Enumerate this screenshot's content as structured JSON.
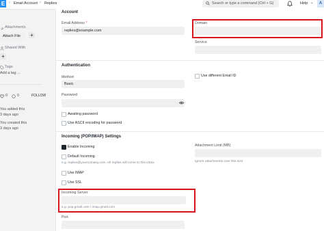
{
  "topbar": {
    "logo": "E",
    "breadcrumbs": [
      "Email Account",
      "Replies"
    ],
    "search_placeholder": "Search or type a command (Ctrl + G)",
    "help_label": "Help",
    "avatar_initial": "A"
  },
  "sidebar": {
    "attachments_label": "Attachments",
    "attach_file_label": "Attach File",
    "shared_with_label": "Shared With",
    "tags_label": "Tags",
    "add_tag_label": "Add a tag ...",
    "likes_count": "0",
    "comments_count": "0",
    "follow_label": "FOLLOW",
    "added_text": "You added this",
    "added_time": "3 days ago",
    "created_text": "You created this",
    "created_time": "3 days ago"
  },
  "account": {
    "section_title": "Account",
    "email_label": "Email Address",
    "email_value": "replies@example.com",
    "domain_label": "Domain",
    "domain_value": "",
    "service_label": "Service",
    "service_value": ""
  },
  "authentication": {
    "section_title": "Authentication",
    "method_label": "Method",
    "method_value": "Basic",
    "use_different_email_label": "Use different Email ID",
    "password_label": "Password",
    "awaiting_password_label": "Awaiting password",
    "ascii_label": "Use ASCII encoding for password"
  },
  "incoming": {
    "section_title": "Incoming (POP/IMAP) Settings",
    "enable_incoming_label": "Enable Incoming",
    "enable_incoming_checked": true,
    "default_incoming_label": "Default Incoming",
    "default_incoming_help": "e.g. replies@yourcomany.com. All replies will come to this inbox.",
    "use_imap_label": "Use IMAP",
    "use_ssl_label": "Use SSL",
    "attachment_limit_label": "Attachment Limit (MB)",
    "attachment_limit_help": "Ignore attachments over this size",
    "incoming_server_label": "Incoming Server",
    "incoming_server_value": "",
    "incoming_server_help": "e.g. pop.gmail.com / imap.gmail.com",
    "port_label": "Port"
  },
  "colors": {
    "highlight": "#d9131c",
    "brand": "#2490ef"
  }
}
